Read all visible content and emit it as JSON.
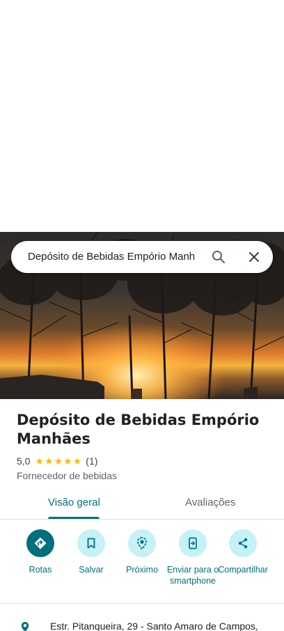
{
  "search": {
    "query": "Depósito de Bebidas Empório Manh"
  },
  "place": {
    "title": "Depósito de Bebidas Empório Manhães",
    "rating": "5,0",
    "stars": 5,
    "review_count": "(1)",
    "category": "Fornecedor de bebidas"
  },
  "tabs": {
    "overview": "Visão geral",
    "reviews": "Avaliações"
  },
  "actions": {
    "routes": "Rotas",
    "save": "Salvar",
    "nearby": "Próximo",
    "send_to_phone": "Enviar para o smartphone",
    "share": "Compartilhar"
  },
  "address": {
    "text": "Estr. Pitanqueira, 29 - Santo Amaro de Campos,"
  },
  "colors": {
    "accent": "#00707d",
    "accent_light": "#c4f2f6",
    "star": "#fbbc04"
  }
}
